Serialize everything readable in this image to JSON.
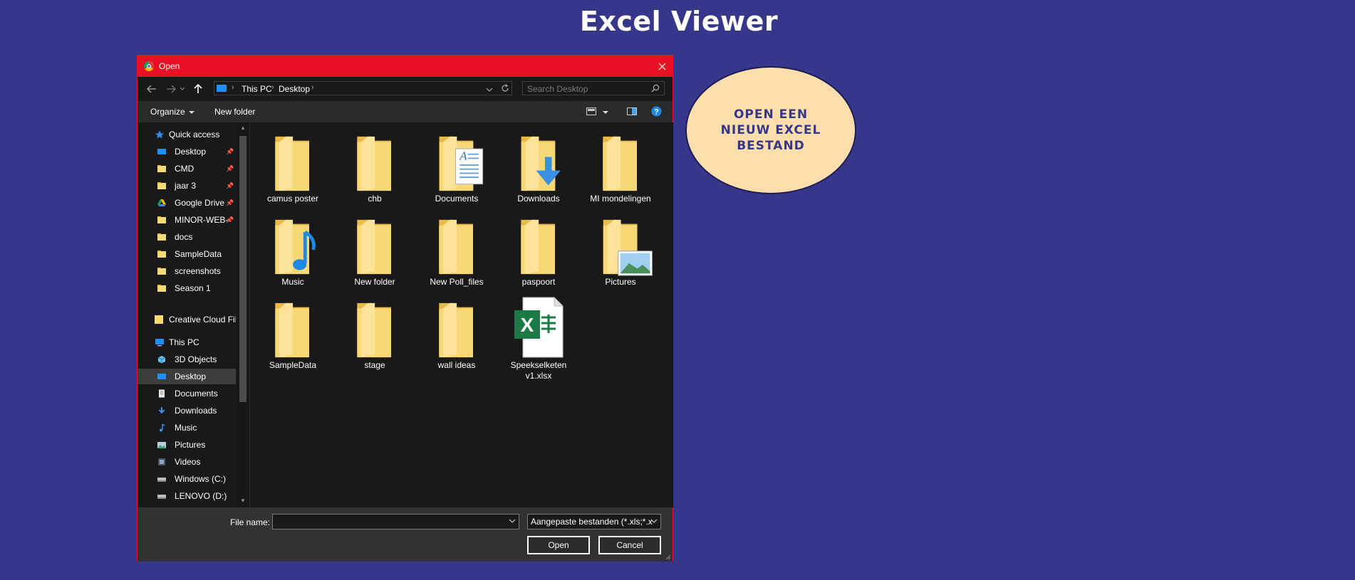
{
  "page": {
    "title": "Excel Viewer",
    "cta_label": "OPEN EEN NIEUW EXCEL BESTAND"
  },
  "dialog": {
    "title": "Open",
    "address": {
      "segments": [
        "This PC",
        "Desktop"
      ]
    },
    "search_placeholder": "Search Desktop",
    "toolbar": {
      "organize": "Organize",
      "new_folder": "New folder"
    },
    "sidebar": {
      "quick_access": "Quick access",
      "items": [
        {
          "label": "Desktop",
          "icon": "desktop-icon",
          "pinned": true
        },
        {
          "label": "CMD",
          "icon": "folder-icon",
          "pinned": true
        },
        {
          "label": "jaar 3",
          "icon": "folder-icon",
          "pinned": true
        },
        {
          "label": "Google Drive",
          "icon": "google-drive-icon",
          "pinned": true
        },
        {
          "label": "MINOR-WEB-",
          "icon": "folder-icon",
          "pinned": true
        },
        {
          "label": "docs",
          "icon": "folder-icon",
          "pinned": false
        },
        {
          "label": "SampleData",
          "icon": "folder-icon",
          "pinned": false
        },
        {
          "label": "screenshots",
          "icon": "folder-icon",
          "pinned": false
        },
        {
          "label": "Season 1",
          "icon": "folder-icon",
          "pinned": false
        }
      ],
      "creative_cloud": "Creative Cloud Fil",
      "this_pc": "This PC",
      "pc_items": [
        {
          "label": "3D Objects",
          "icon": "3d-objects-icon"
        },
        {
          "label": "Desktop",
          "icon": "desktop-icon",
          "selected": true
        },
        {
          "label": "Documents",
          "icon": "documents-icon"
        },
        {
          "label": "Downloads",
          "icon": "downloads-icon"
        },
        {
          "label": "Music",
          "icon": "music-icon"
        },
        {
          "label": "Pictures",
          "icon": "pictures-icon"
        },
        {
          "label": "Videos",
          "icon": "videos-icon"
        },
        {
          "label": "Windows (C:)",
          "icon": "drive-icon"
        },
        {
          "label": "LENOVO (D:)",
          "icon": "drive-icon"
        }
      ]
    },
    "files": [
      {
        "name": "camus poster",
        "type": "folder"
      },
      {
        "name": "chb",
        "type": "folder"
      },
      {
        "name": "Documents",
        "type": "folder-documents"
      },
      {
        "name": "Downloads",
        "type": "folder-downloads"
      },
      {
        "name": "MI mondelingen",
        "type": "folder"
      },
      {
        "name": "Music",
        "type": "folder-music"
      },
      {
        "name": "New folder",
        "type": "folder"
      },
      {
        "name": "New Poll_files",
        "type": "folder"
      },
      {
        "name": "paspoort",
        "type": "folder"
      },
      {
        "name": "Pictures",
        "type": "folder-pictures"
      },
      {
        "name": "SampleData",
        "type": "folder"
      },
      {
        "name": "stage",
        "type": "folder"
      },
      {
        "name": "wall ideas",
        "type": "folder"
      },
      {
        "name": "Speekselketen v1.xlsx",
        "type": "excel"
      }
    ],
    "bottom": {
      "file_name_label": "File name:",
      "file_name_value": "",
      "file_type": "Aangepaste bestanden (*.xls;*.x",
      "open": "Open",
      "cancel": "Cancel"
    }
  },
  "colors": {
    "background": "#36378a",
    "titlebar": "#e81123",
    "cta_fill": "#ffdead",
    "cta_text": "#35378a"
  }
}
